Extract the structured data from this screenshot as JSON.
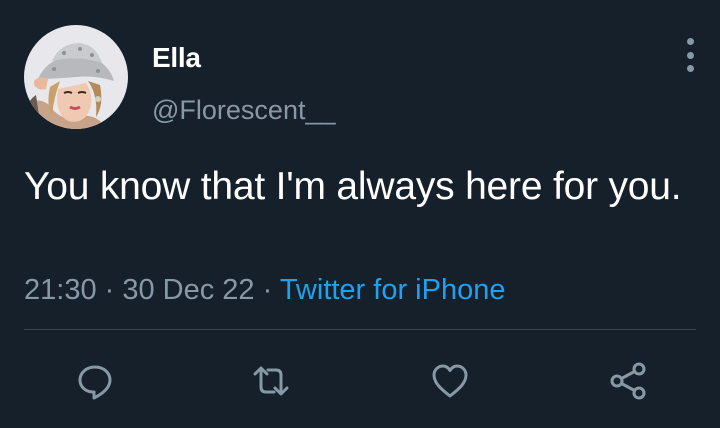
{
  "tweet": {
    "display_name": "Ella",
    "handle": "@Florescent__",
    "text": "You know that I'm always here for you.",
    "time": "21:30",
    "separator": " · ",
    "date": "30 Dec 22",
    "source": "Twitter for iPhone"
  },
  "actions": [
    {
      "name": "reply",
      "icon": "speech-bubble-icon"
    },
    {
      "name": "retweet",
      "icon": "retweet-arrows-icon"
    },
    {
      "name": "like",
      "icon": "heart-icon"
    },
    {
      "name": "share",
      "icon": "share-nodes-icon"
    }
  ],
  "colors": {
    "background": "#15202b",
    "text": "#ffffff",
    "secondary": "#8899a6",
    "link": "#1da1f2",
    "divider": "#38444d"
  }
}
